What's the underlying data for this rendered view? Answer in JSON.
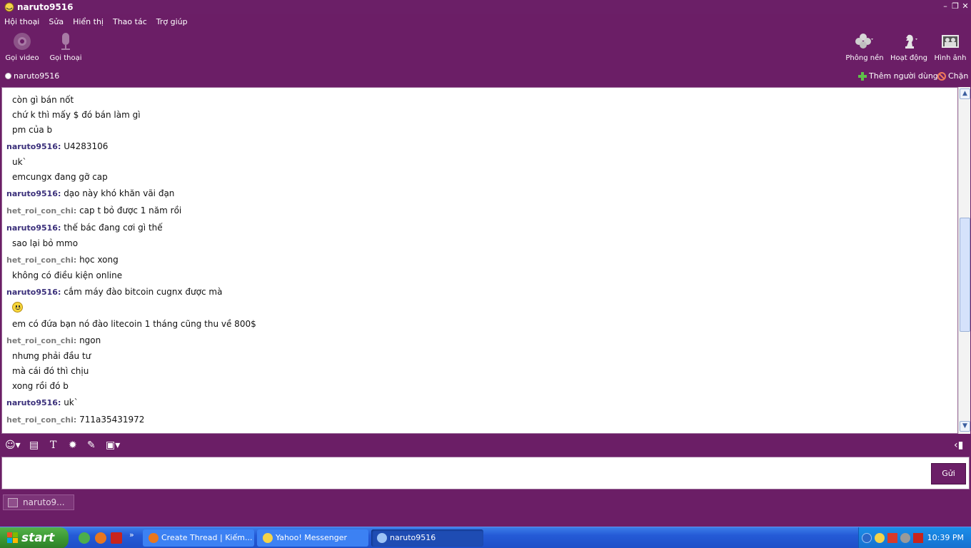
{
  "window": {
    "title": "naruto9516"
  },
  "menu": [
    "Hội thoại",
    "Sửa",
    "Hiển thị",
    "Thao tác",
    "Trợ giúp"
  ],
  "toolbar": {
    "video_call": "Gọi video",
    "voice_call": "Gọi thoại",
    "background": "Phông nền",
    "activity": "Hoạt động",
    "images": "Hình ảnh"
  },
  "contact": {
    "name": "naruto9516",
    "add_user": "Thêm người dùng",
    "block": "Chặn"
  },
  "messages": [
    {
      "nick": "",
      "text": "còn gì bán nốt"
    },
    {
      "nick": "",
      "text": "chứ k thì mấy $ đó bán làm gì"
    },
    {
      "nick": "",
      "text": "pm của b"
    },
    {
      "nick": "naruto9516",
      "text": "U4283106"
    },
    {
      "nick": "",
      "text": "uk`"
    },
    {
      "nick": "",
      "text": "emcungx đang gỡ cap"
    },
    {
      "nick": "naruto9516",
      "text": "dạo này khó khăn vãi đạn"
    },
    {
      "nick": "het_roi_con_chi",
      "text": "cap t bỏ được 1 năm rồi"
    },
    {
      "nick": "naruto9516",
      "text": "thế bác đang cơi gì thế"
    },
    {
      "nick": "",
      "text": "sao lại bỏ mmo"
    },
    {
      "nick": "het_roi_con_chi",
      "text": "học xong"
    },
    {
      "nick": "",
      "text": "không có điều kiện online"
    },
    {
      "nick": "naruto9516",
      "text": "cắm máy đào bitcoin cugnx được mà"
    },
    {
      "nick": "",
      "text": ""
    },
    {
      "nick": "",
      "text": "em có đứa bạn nó đào litecoin 1 tháng cũng thu về 800$"
    },
    {
      "nick": "het_roi_con_chi",
      "text": "ngon"
    },
    {
      "nick": "",
      "text": "nhưng phải đầu tư"
    },
    {
      "nick": "",
      "text": "mà cái đó thì chịu"
    },
    {
      "nick": "",
      "text": "xong rồi đó b"
    },
    {
      "nick": "naruto9516",
      "text": "uk`"
    },
    {
      "nick": "het_roi_con_chi",
      "text": "711a35431972"
    }
  ],
  "input": {
    "send_label": "Gửi",
    "value": ""
  },
  "conv_tab": {
    "label": "naruto9..."
  },
  "taskbar": {
    "start": "start",
    "tasks": [
      {
        "label": "Create Thread | Kiếm...",
        "icon": "firefox-icon"
      },
      {
        "label": "Yahoo! Messenger",
        "icon": "yahoo-smiley-icon"
      },
      {
        "label": "naruto9516",
        "icon": "messenger-icon"
      }
    ],
    "clock": "10:39 PM"
  },
  "colors": {
    "theme_purple": "#6b1e66",
    "my_nick": "#3a2f7a",
    "other_nick": "#7b7b7b"
  }
}
